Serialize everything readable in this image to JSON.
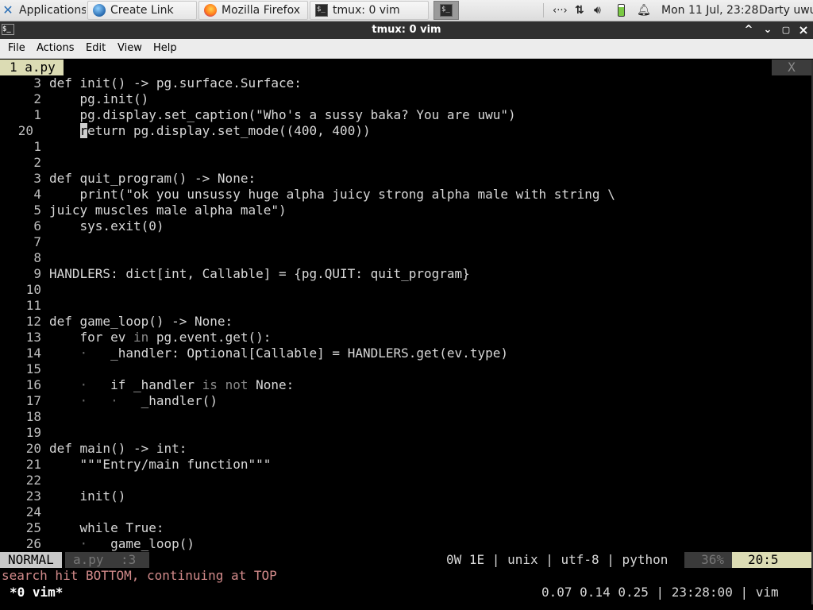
{
  "panel": {
    "applications_label": "Applications",
    "tasks": [
      {
        "label": "Create Link",
        "icon": "globe-icon"
      },
      {
        "label": "Mozilla Firefox",
        "icon": "firefox-icon"
      },
      {
        "label": "tmux: 0 vim",
        "icon": "terminal-icon"
      }
    ],
    "active_task_icon": "terminal-icon",
    "tray": {
      "network_icon": "network-icon",
      "transfer_icon": "transfer-arrows-icon",
      "volume_icon": "volume-icon",
      "battery_icon": "battery-icon",
      "notification_icon": "bell-icon",
      "clock": "Mon 11 Jul, 23:28",
      "user": "Darty uwu"
    }
  },
  "window": {
    "title": "tmux: 0 vim",
    "minimize_glyph": "^",
    "maximize_glyph": "▢",
    "close_glyph": "×"
  },
  "menubar": [
    "File",
    "Actions",
    "Edit",
    "View",
    "Help"
  ],
  "vim": {
    "tab_label": "1 a.py",
    "tab_close": "X",
    "lines": [
      {
        "n": "3",
        "code": "def init() -> pg.surface.Surface:"
      },
      {
        "n": "2",
        "code": "    pg.init()"
      },
      {
        "n": "1",
        "code": "    pg.display.set_caption(\"Who's a sussy baka? You are uwu\")"
      },
      {
        "n": "20",
        "code": "    return pg.display.set_mode((400, 400))",
        "current": true
      },
      {
        "n": "1",
        "code": ""
      },
      {
        "n": "2",
        "code": ""
      },
      {
        "n": "3",
        "code": "def quit_program() -> None:"
      },
      {
        "n": "4",
        "code": "    print(\"ok you unsussy huge alpha juicy strong alpha male with string \\"
      },
      {
        "n": "5",
        "code": "juicy muscles male alpha male\")"
      },
      {
        "n": "6",
        "code": "    sys.exit(0)"
      },
      {
        "n": "7",
        "code": ""
      },
      {
        "n": "8",
        "code": ""
      },
      {
        "n": "9",
        "code": "HANDLERS: dict[int, Callable] = {pg.QUIT: quit_program}"
      },
      {
        "n": "10",
        "code": ""
      },
      {
        "n": "11",
        "code": ""
      },
      {
        "n": "12",
        "code": "def game_loop() -> None:"
      },
      {
        "n": "13",
        "code": "    for ev in pg.event.get():"
      },
      {
        "n": "14",
        "code": "    ·   _handler: Optional[Callable] = HANDLERS.get(ev.type)"
      },
      {
        "n": "15",
        "code": ""
      },
      {
        "n": "16",
        "code": "    ·   if _handler is not None:"
      },
      {
        "n": "17",
        "code": "    ·   ·   _handler()"
      },
      {
        "n": "18",
        "code": ""
      },
      {
        "n": "19",
        "code": ""
      },
      {
        "n": "20",
        "code": "def main() -> int:"
      },
      {
        "n": "21",
        "code": "    \"\"\"Entry/main function\"\"\""
      },
      {
        "n": "22",
        "code": ""
      },
      {
        "n": "23",
        "code": "    init()"
      },
      {
        "n": "24",
        "code": ""
      },
      {
        "n": "25",
        "code": "    while True:"
      },
      {
        "n": "26",
        "code": "    ·   game_loop()"
      }
    ],
    "status": {
      "mode": "NORMAL",
      "file": "a.py",
      "file_info": ":3",
      "right": "0W 1E | unix | utf-8 | python",
      "percent": "36%",
      "position": "20:5"
    },
    "message": "search hit BOTTOM, continuing at TOP"
  },
  "tmux": {
    "window": "*0 vim*",
    "right": "0.07 0.14 0.25 | 23:28:00 | vim"
  }
}
